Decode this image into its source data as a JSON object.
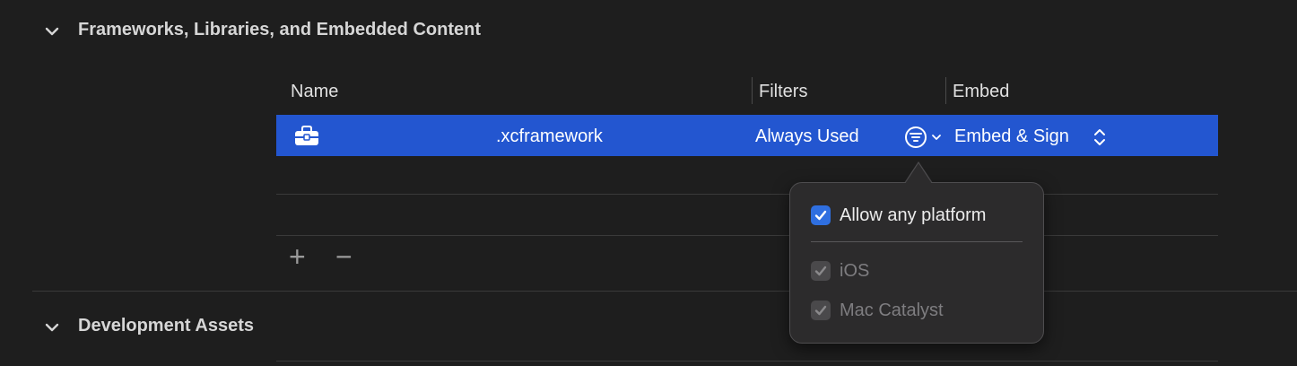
{
  "sections": {
    "frameworks": {
      "title": "Frameworks, Libraries, and Embedded Content"
    },
    "development_assets": {
      "title": "Development Assets"
    }
  },
  "table": {
    "columns": {
      "name": "Name",
      "filters": "Filters",
      "embed": "Embed"
    },
    "selected_row": {
      "icon": "toolbox-icon",
      "name": ".xcframework",
      "filters": "Always Used",
      "embed": "Embed & Sign"
    }
  },
  "toolbar": {
    "add_label": "+",
    "remove_label": "−"
  },
  "popover": {
    "allow_any_platform": {
      "label": "Allow any platform",
      "checked": true
    },
    "platforms": [
      {
        "label": "iOS",
        "checked": true,
        "enabled": false
      },
      {
        "label": "Mac Catalyst",
        "checked": true,
        "enabled": false
      }
    ]
  },
  "colors": {
    "selection": "#2356d0",
    "background": "#1e1e1e",
    "checkbox_on": "#2f6fe0"
  }
}
